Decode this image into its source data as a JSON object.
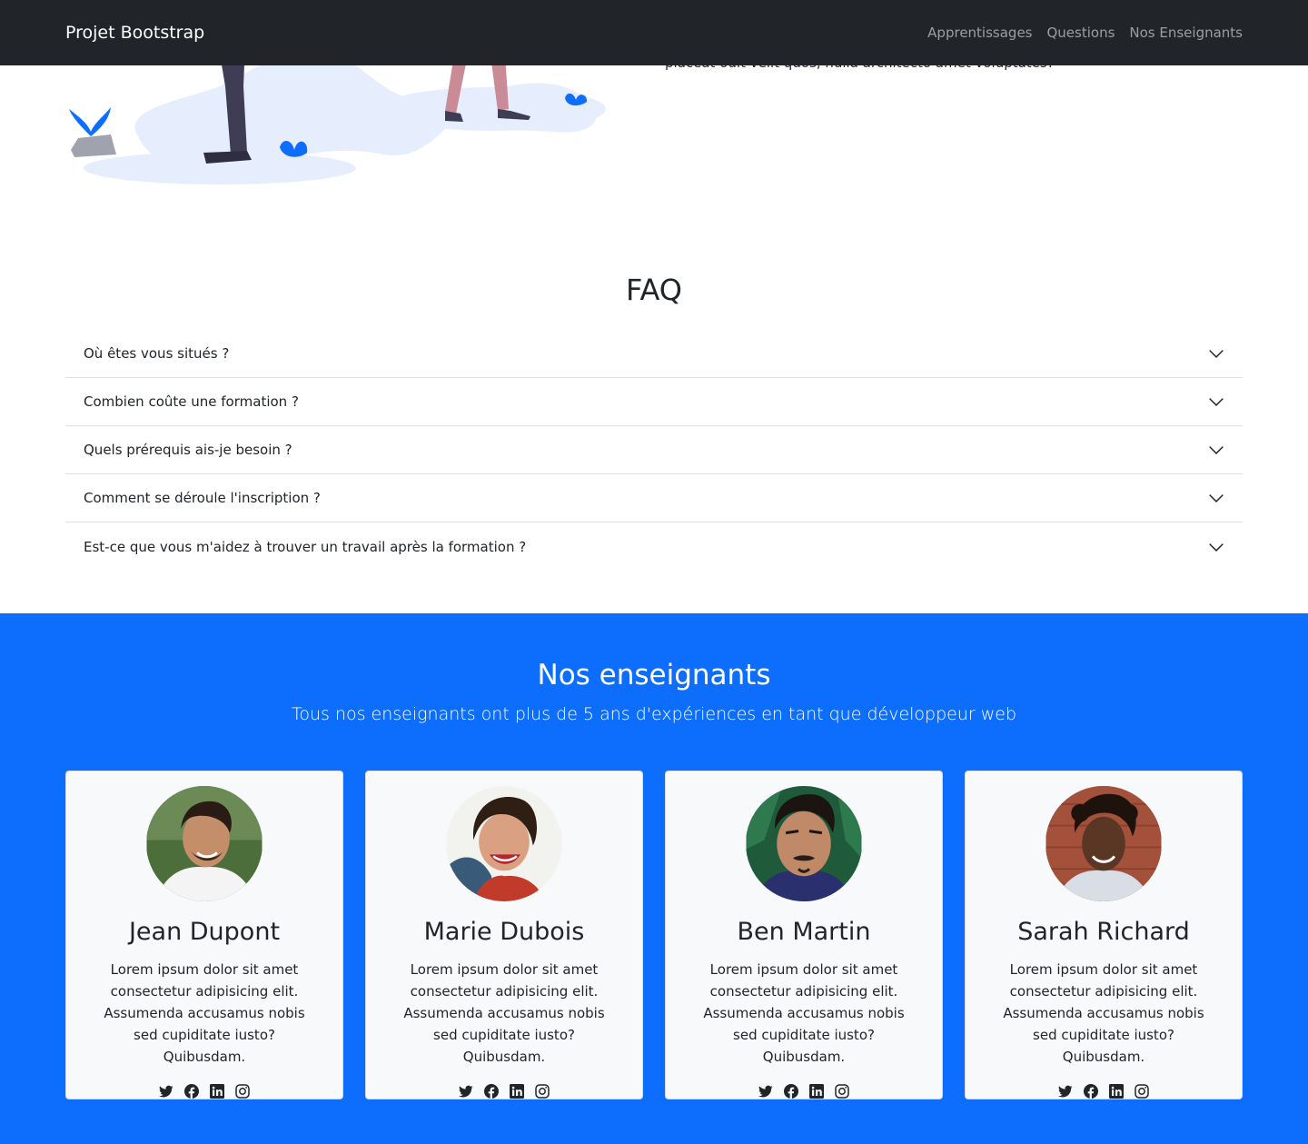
{
  "navbar": {
    "brand": "Projet Bootstrap",
    "links": [
      "Apprentissages",
      "Questions",
      "Nos Enseignants"
    ]
  },
  "hero": {
    "text_fragment": "placeat odit velit quos, nulla architecto amet voluptates?"
  },
  "faq": {
    "title": "FAQ",
    "items": [
      "Où êtes vous situés ?",
      "Combien coûte une formation ?",
      "Quels prérequis ais-je besoin ?",
      "Comment se déroule l'inscription ?",
      "Est-ce que vous m'aidez à trouver un travail après la formation ?"
    ]
  },
  "teachers": {
    "title": "Nos enseignants",
    "subtitle": "Tous nos enseignants ont plus de 5 ans d'expériences en tant que développeur web",
    "cards": [
      {
        "name": "Jean Dupont",
        "text": "Lorem ipsum dolor sit amet consectetur adipisicing elit. Assumenda accusamus nobis sed cupiditate iusto? Quibusdam."
      },
      {
        "name": "Marie Dubois",
        "text": "Lorem ipsum dolor sit amet consectetur adipisicing elit. Assumenda accusamus nobis sed cupiditate iusto? Quibusdam."
      },
      {
        "name": "Ben Martin",
        "text": "Lorem ipsum dolor sit amet consectetur adipisicing elit. Assumenda accusamus nobis sed cupiditate iusto? Quibusdam."
      },
      {
        "name": "Sarah Richard",
        "text": "Lorem ipsum dolor sit amet consectetur adipisicing elit. Assumenda accusamus nobis sed cupiditate iusto? Quibusdam."
      }
    ],
    "social_icons": [
      "twitter-icon",
      "facebook-icon",
      "linkedin-icon",
      "instagram-icon"
    ]
  },
  "colors": {
    "navbar_bg": "#212529",
    "primary": "#0d6efd",
    "card_bg": "#f8f9fa",
    "illustration_blob": "#e6edfd",
    "illustration_accent": "#0d6efd"
  }
}
